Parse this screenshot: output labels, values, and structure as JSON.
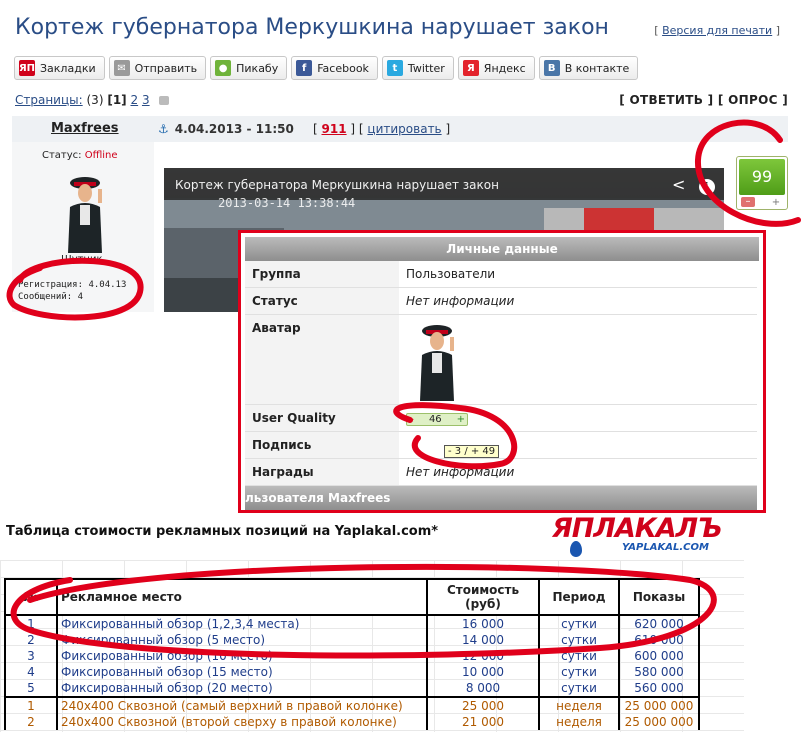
{
  "header": {
    "title": "Кортеж губернатора Меркушкина нарушает закон",
    "print_link": "Версия для печати"
  },
  "share_buttons": [
    {
      "label": "Закладки",
      "icon": "yandex-bookmark-icon",
      "color": "#d0021b",
      "glyph": "ЯП"
    },
    {
      "label": "Отправить",
      "icon": "mail-icon",
      "color": "#9a9a9a",
      "glyph": "✉"
    },
    {
      "label": "Пикабу",
      "icon": "pikabu-icon",
      "color": "#6fb33a",
      "glyph": "●"
    },
    {
      "label": "Facebook",
      "icon": "facebook-icon",
      "color": "#3b5998",
      "glyph": "f"
    },
    {
      "label": "Twitter",
      "icon": "twitter-icon",
      "color": "#2aa9e0",
      "glyph": "t"
    },
    {
      "label": "Яндекс",
      "icon": "yandex-icon",
      "color": "#e3232c",
      "glyph": "Я"
    },
    {
      "label": "В контакте",
      "icon": "vk-icon",
      "color": "#4a76a8",
      "glyph": "B"
    }
  ],
  "pagination": {
    "label": "Страницы:",
    "count": "(3)",
    "current": "[1]",
    "p2": "2",
    "p3": "3"
  },
  "actions": {
    "reply": "[ ОТВЕТИТЬ ]",
    "poll": "[ ОПРОС ]"
  },
  "post": {
    "author": "Maxfrees",
    "date": "4.04.2013 - 11:50",
    "num_prefix": "[",
    "number": "911",
    "num_mid": "] [",
    "quote": "цитировать",
    "num_suffix": "]",
    "status_label": "Статус:",
    "status_value": "Offline",
    "rank": "Шутник",
    "stats": "Регистрация: 4.04.13\nСообщений: 4",
    "rating": "99",
    "rating_minus": "–",
    "rating_plus": "+"
  },
  "video": {
    "title": "Кортеж губернатора Меркушкина нарушает закон",
    "timestamp": "2013-03-14  13:38:44",
    "share_icon": "share-icon",
    "info_icon": "info-icon"
  },
  "popup": {
    "title": "Личные данные",
    "rows": [
      {
        "key": "Группа",
        "value": "Пользователи"
      },
      {
        "key": "Статус",
        "value": "Нет информации"
      },
      {
        "key": "Аватар",
        "value": ""
      },
      {
        "key": "User Quality",
        "value": "46"
      },
      {
        "key": "Подпись",
        "value": ""
      },
      {
        "key": "Награды",
        "value": "Нет информации"
      }
    ],
    "tooltip": "- 3 / + 49",
    "footer": "льзователя Maxfrees"
  },
  "sheet": {
    "title": "Таблица стоимости рекламных позиций на Yaplakal.com*",
    "logo_main": "ЯПЛАКАЛЪ",
    "logo_sub": "YAPLAKAL.COM",
    "headers": [
      "№",
      "Рекламное место",
      "Стоимость (руб)",
      "Период",
      "Показы"
    ],
    "rows": [
      {
        "n": "1",
        "place": "Фиксированный обзор (1,2,3,4 места)",
        "price": "16 000",
        "period": "сутки",
        "shows": "620 000",
        "tone": "blue"
      },
      {
        "n": "2",
        "place": "Фиксированный обзор (5 место)",
        "price": "14 000",
        "period": "сутки",
        "shows": "610 000",
        "tone": "blue"
      },
      {
        "n": "3",
        "place": "Фиксированный обзор (10 место)",
        "price": "12 000",
        "period": "сутки",
        "shows": "600 000",
        "tone": "blue"
      },
      {
        "n": "4",
        "place": "Фиксированный обзор (15 место)",
        "price": "10 000",
        "period": "сутки",
        "shows": "580 000",
        "tone": "blue"
      },
      {
        "n": "5",
        "place": "Фиксированный обзор (20 место)",
        "price": "8 000",
        "period": "сутки",
        "shows": "560 000",
        "tone": "blue"
      },
      {
        "n": "1",
        "place": "240х400 Сквозной (самый верхний в правой колонке)",
        "price": "25 000",
        "period": "неделя",
        "shows": "25 000 000",
        "tone": "orange"
      },
      {
        "n": "2",
        "place": "240х400 Сквозной (второй сверху в правой колонке)",
        "price": "21 000",
        "period": "неделя",
        "shows": "25 000 000",
        "tone": "orange"
      }
    ]
  },
  "colors": {
    "link": "#2a4d86",
    "accent_red": "#e0001b",
    "rating_green": "#5fae25"
  }
}
